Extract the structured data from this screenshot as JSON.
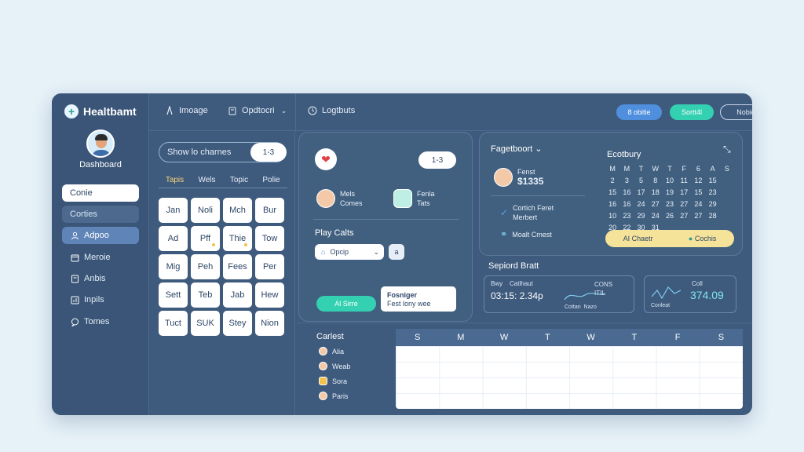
{
  "app": {
    "brand": "Healtbamt"
  },
  "sidebar": {
    "profile_label": "Dashboard",
    "items": [
      {
        "label": "Conie",
        "icon": "none"
      },
      {
        "label": "Corties",
        "icon": "none"
      },
      {
        "label": "Adpoo",
        "icon": "person-icon"
      },
      {
        "label": "Meroie",
        "icon": "calendar-icon"
      },
      {
        "label": "Anbis",
        "icon": "note-icon"
      },
      {
        "label": "Inpils",
        "icon": "chart-icon"
      },
      {
        "label": "Tomes",
        "icon": "chat-icon"
      }
    ]
  },
  "topbar": {
    "item1": "Imoage",
    "item2": "Opdtocri",
    "item3": "Logtbuts",
    "btn_blue": "8 obitie",
    "btn_teal": "Sortt4l",
    "btn_outline": "Nobie",
    "avatar": "A"
  },
  "wordgrid": {
    "search_label": "Show lo charnes",
    "search_count": "1-3",
    "headers": [
      "Tapis",
      "Wels",
      "Topic",
      "Polie"
    ],
    "cells": [
      "Jan",
      "Noli",
      "Mch",
      "Bur",
      "Ad",
      "Pff",
      "Thie",
      "Tow",
      "Mig",
      "Peh",
      "Fees",
      "Per",
      "Sett",
      "Teb",
      "Jab",
      "Hew",
      "Tuct",
      "SUK",
      "Stey",
      "Nion"
    ]
  },
  "center": {
    "pill_count": "1-3",
    "user1_line1": "Mels",
    "user1_line2": "Comes",
    "user2_line1": "Fenla",
    "user2_line2": "Tats",
    "section": "Play Calts",
    "dropdown": "Opcip",
    "small_btn": "a",
    "teal_btn": "Al Sirre",
    "card_title": "Fosniger",
    "card_sub": "Fest lony wee"
  },
  "right": {
    "title": "Fagetboort",
    "user_name": "Fenst",
    "user_value": "$1335",
    "item1_line1": "Cortich Feret",
    "item1_line2": "Merbert",
    "item2": "Moalt Cmest",
    "cal_title": "Ecotbury",
    "cal_days": [
      "M",
      "M",
      "T",
      "W",
      "T",
      "F",
      "6",
      "A",
      "S"
    ],
    "cal_dates": [
      "",
      "",
      "",
      "",
      "",
      "",
      "",
      "",
      "",
      "2",
      "3",
      "5",
      "8",
      "10",
      "11",
      "12",
      "15",
      "",
      "15",
      "16",
      "17",
      "18",
      "19",
      "17",
      "15",
      "23",
      "",
      "16",
      "16",
      "24",
      "27",
      "23",
      "27",
      "24",
      "29",
      "",
      "10",
      "23",
      "29",
      "24",
      "26",
      "27",
      "27",
      "28",
      "",
      "20",
      "22",
      "30",
      "31",
      "",
      "",
      "",
      "",
      ""
    ],
    "cal_selected": "17",
    "bar_left": "AI Chaetr",
    "bar_right": "Cochis"
  },
  "chart": {
    "title": "Sepiord Bratt",
    "card1_label1": "Bwy",
    "card1_label2": "Catlhaut",
    "card1_value": "03:15: 2.34p",
    "card1_right1": "CONS",
    "card1_right2": "ITIL",
    "card1_bottom1": "Cottan",
    "card1_bottom2": "Nazo",
    "card2_label": "Coll",
    "card2_value": "374.09",
    "card2_sub": "Conleat"
  },
  "schedule": {
    "title": "Carlest",
    "days": [
      "S",
      "M",
      "W",
      "T",
      "W",
      "T",
      "F",
      "S"
    ],
    "legend": [
      "Alia",
      "Weab",
      "Sora",
      "Paris"
    ]
  }
}
